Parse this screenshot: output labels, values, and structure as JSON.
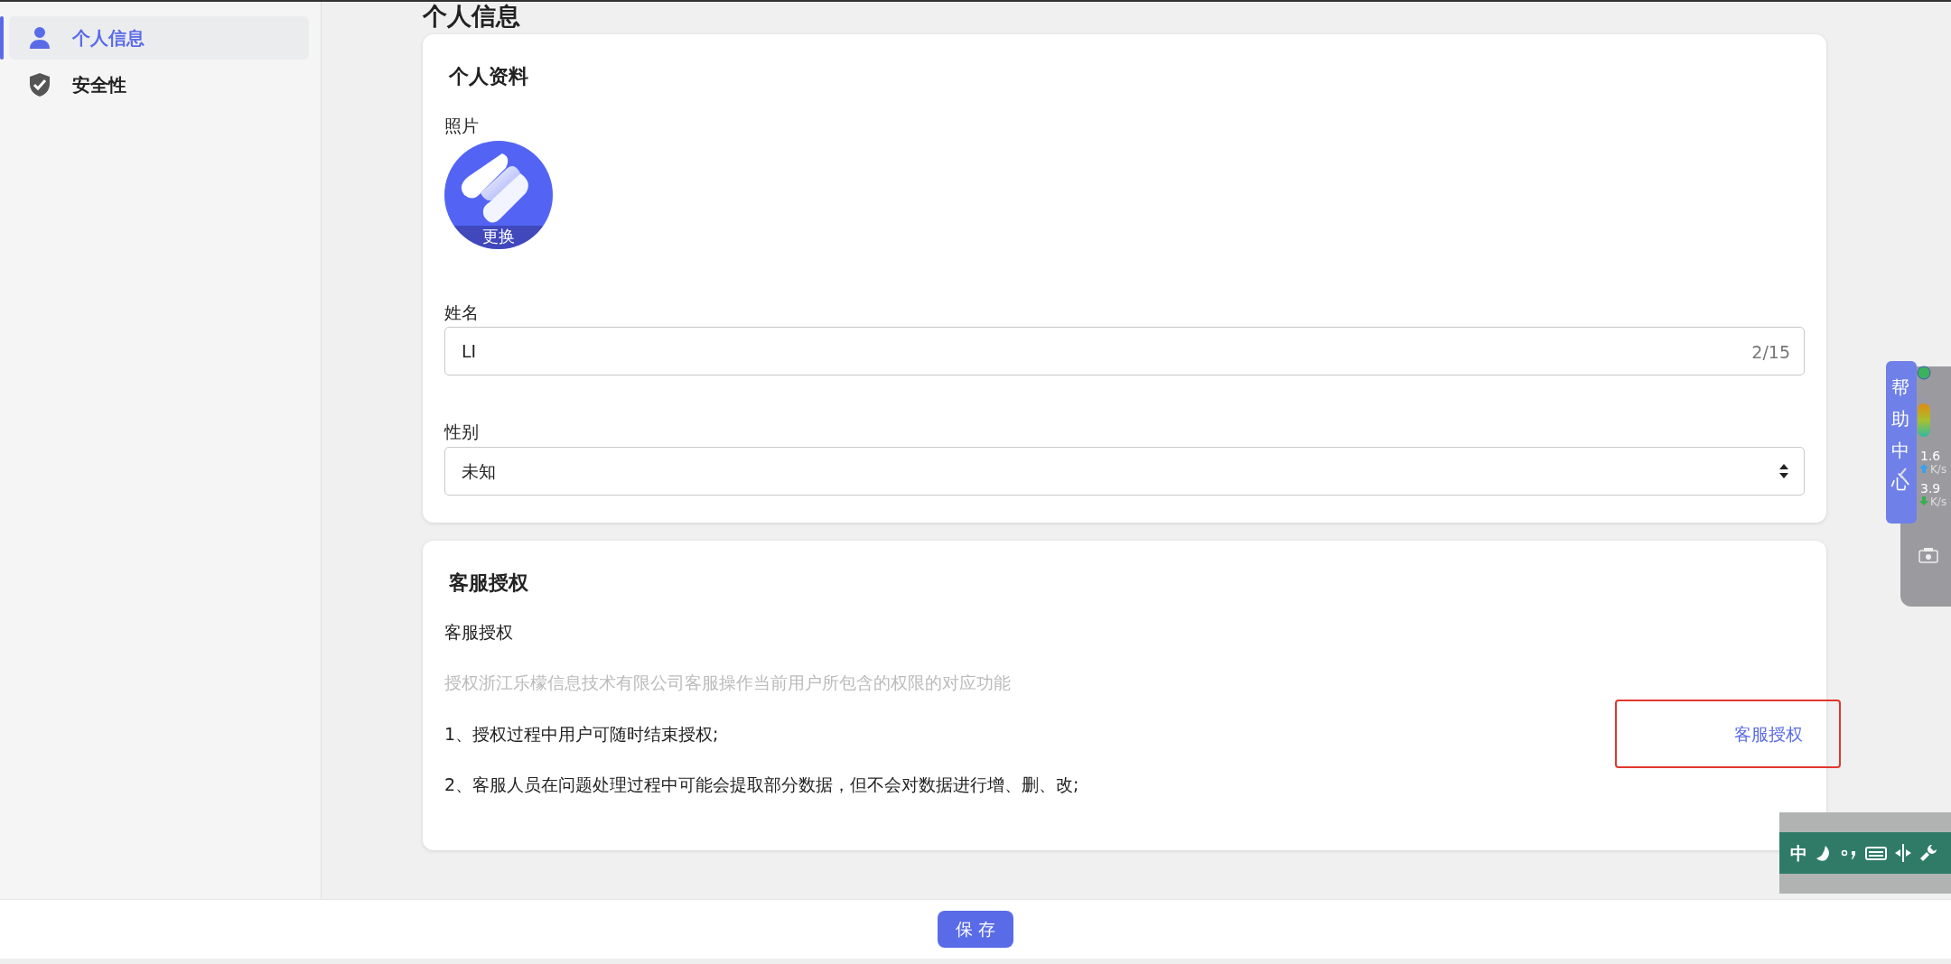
{
  "sidebar": {
    "items": [
      {
        "label": "个人信息",
        "kind": "person",
        "selected": true
      },
      {
        "label": "安全性",
        "kind": "shield",
        "selected": false
      }
    ]
  },
  "page_title": "个人信息",
  "profile_card": {
    "title": "个人资料",
    "photo_label": "照片",
    "photo_action": "更换",
    "name_label": "姓名",
    "name_value": "LI",
    "name_counter": "2/15",
    "gender_label": "性别",
    "gender_value": "未知"
  },
  "auth_card": {
    "title": "客服授权",
    "subtitle": "客服授权",
    "description": "授权浙江乐檬信息技术有限公司客服操作当前用户所包含的权限的对应功能",
    "notes": [
      "1、授权过程中用户可随时结束授权;",
      "2、客服人员在问题处理过程中可能会提取部分数据，但不会对数据进行增、删、改;"
    ],
    "link": "客服授权",
    "highlighted": true
  },
  "footer": {
    "save_button": "保 存"
  },
  "help_widget": {
    "label": "帮助中心",
    "upload_rate": "1.6",
    "upload_unit": "K/s",
    "download_rate": "3.9",
    "download_unit": "K/s"
  },
  "ime_toolbar": {
    "mode": "中"
  }
}
